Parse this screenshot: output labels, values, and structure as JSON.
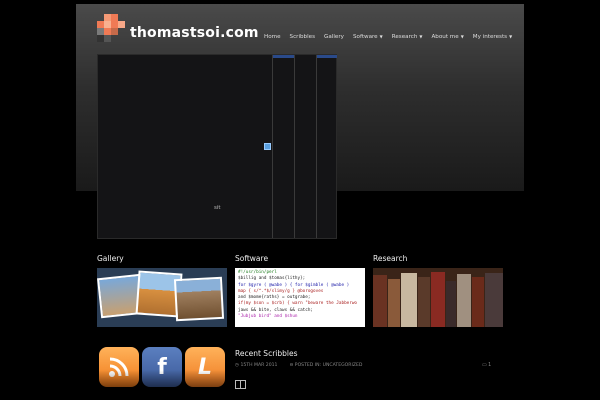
{
  "site": {
    "name": "thomastsoi.com"
  },
  "nav": [
    {
      "label": "Home",
      "dropdown": false
    },
    {
      "label": "Scribbles",
      "dropdown": false
    },
    {
      "label": "Gallery",
      "dropdown": false
    },
    {
      "label": "Software",
      "dropdown": true
    },
    {
      "label": "Research",
      "dropdown": true
    },
    {
      "label": "About me",
      "dropdown": true
    },
    {
      "label": "My interests",
      "dropdown": true
    }
  ],
  "slider": {
    "caption": "sit"
  },
  "sections": {
    "gallery": "Gallery",
    "software": "Software",
    "research": "Research"
  },
  "code_lines": [
    "#!/usr/bin/perl",
    "$billig and $tomas{lithy};",
    "for $gyre ( @wabe ) {  for $gimble ( @wabe )",
    "map { s/^.*$/slimy/g } @borogoves",
    "and $mome{raths} = outgrabe;",
    "if(my $son = $crb) { warn \"beware the Jabberwo",
    "jaws && bite, claws && catch;",
    "         \"Jubjub bird\" and $shun"
  ],
  "recent": {
    "title": "Recent Scribbles",
    "date": "15TH MAR 2011",
    "category": "POSTED IN: UNCATEGORIZED",
    "comments": "1"
  },
  "colors": {
    "logo_primary": "#f0956a",
    "logo_secondary": "#5a5a5a",
    "background": "#000000"
  }
}
